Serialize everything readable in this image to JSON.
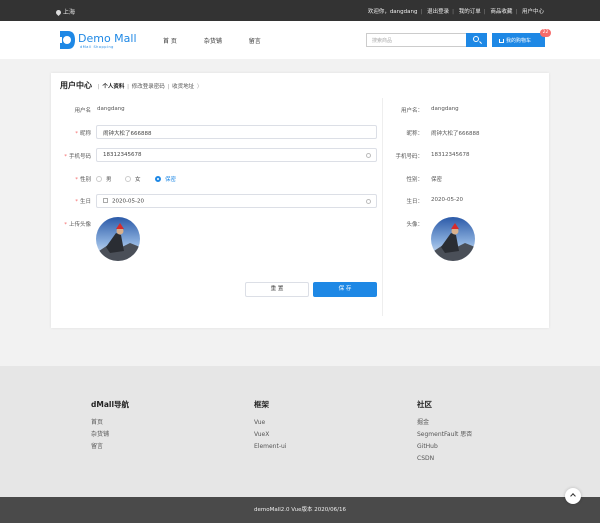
{
  "topbar": {
    "location": "上海",
    "links": [
      "欢迎你，dangdang",
      "退出登录",
      "我的订单",
      "商品收藏",
      "用户中心"
    ]
  },
  "header": {
    "logo_text": "Demo Mall",
    "logo_sub": "dMall Shopping",
    "nav": [
      "首 页",
      "杂货铺",
      "留言"
    ],
    "search_placeholder": "搜索商品",
    "cart_label": "我的购物车",
    "cart_count": "22"
  },
  "profile": {
    "title": "用户中心",
    "tabs": [
      "个人资料",
      "修改登录密码",
      "收货地址"
    ],
    "form": {
      "username_label": "用户名",
      "username": "dangdang",
      "nickname_label": "昵称",
      "nickname": "闹钟大松了666888",
      "phone_label": "手机号码",
      "phone": "18312345678",
      "gender_label": "性别",
      "gender_options": [
        "男",
        "女",
        "保密"
      ],
      "gender_selected": "保密",
      "birthday_label": "生日",
      "birthday": "2020-05-20",
      "avatar_label": "上传头像",
      "reset_label": "重 置",
      "save_label": "保 存"
    },
    "preview": {
      "username_label": "用户名：",
      "username": "dangdang",
      "nickname_label": "昵称：",
      "nickname": "闹钟大松了666888",
      "phone_label": "手机号码：",
      "phone": "18312345678",
      "gender_label": "性别：",
      "gender": "保密",
      "birthday_label": "生日：",
      "birthday": "2020-05-20",
      "avatar_label": "头像："
    }
  },
  "footer": {
    "columns": [
      {
        "title": "dMall导航",
        "items": [
          "首页",
          "杂货铺",
          "留言"
        ]
      },
      {
        "title": "框架",
        "items": [
          "Vue",
          "VueX",
          "Element-ui"
        ]
      },
      {
        "title": "社区",
        "items": [
          "掘金",
          "SegmentFault 思否",
          "GitHub",
          "CSDN"
        ]
      }
    ],
    "copyright": "demoMall2.0 Vue版本 2020/06/16"
  },
  "colors": {
    "accent": "#1e88e5",
    "topbar": "#333333",
    "required": "#f56c6c"
  }
}
